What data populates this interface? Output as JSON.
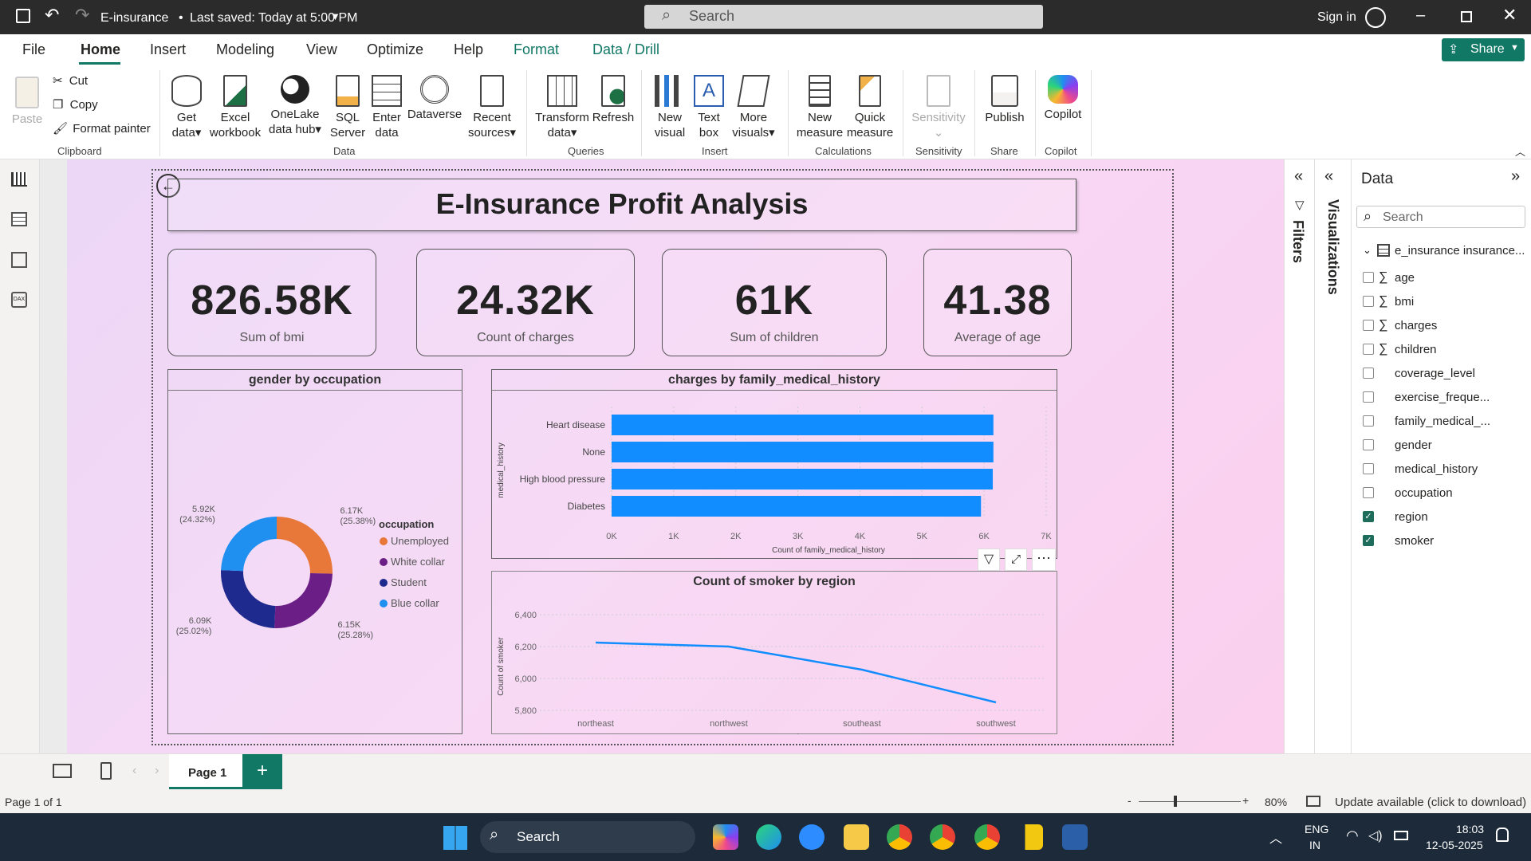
{
  "titlebar": {
    "doc": "E-insurance",
    "saved": "Last saved: Today at 5:00 PM",
    "search": "Search",
    "signin": "Sign in"
  },
  "menu": {
    "file": "File",
    "home": "Home",
    "insert": "Insert",
    "modeling": "Modeling",
    "view": "View",
    "optimize": "Optimize",
    "help": "Help",
    "format": "Format",
    "datadrill": "Data / Drill",
    "share": "Share"
  },
  "ribbon": {
    "paste": "Paste",
    "cut": "Cut",
    "copy": "Copy",
    "format_painter": "Format painter",
    "clipboard": "Clipboard",
    "get_data_1": "Get",
    "get_data_2": "data",
    "excel_1": "Excel",
    "excel_2": "workbook",
    "onelake_1": "OneLake",
    "onelake_2": "data hub",
    "sql_1": "SQL",
    "sql_2": "Server",
    "enter_1": "Enter",
    "enter_2": "data",
    "dataverse": "Dataverse",
    "recent_1": "Recent",
    "recent_2": "sources",
    "data": "Data",
    "transform_1": "Transform",
    "transform_2": "data",
    "refresh": "Refresh",
    "queries": "Queries",
    "newvisual_1": "New",
    "newvisual_2": "visual",
    "textbox_1": "Text",
    "textbox_2": "box",
    "more_1": "More",
    "more_2": "visuals",
    "insert": "Insert",
    "newmeasure_1": "New",
    "newmeasure_2": "measure",
    "quick_1": "Quick",
    "quick_2": "measure",
    "calculations": "Calculations",
    "sensitivity": "Sensitivity",
    "sensitivity_group": "Sensitivity",
    "publish": "Publish",
    "share_group": "Share",
    "copilot": "Copilot",
    "copilot_group": "Copilot"
  },
  "report": {
    "title": "E-Insurance Profit Analysis",
    "kpis": [
      {
        "value": "826.58K",
        "label": "Sum of bmi"
      },
      {
        "value": "24.32K",
        "label": "Count of charges"
      },
      {
        "value": "61K",
        "label": "Sum of children"
      },
      {
        "value": "41.38",
        "label": "Average of age"
      }
    ]
  },
  "donut": {
    "title": "gender by occupation",
    "legend_title": "occupation",
    "labels": [
      {
        "v": "6.17K",
        "p": "(25.38%)"
      },
      {
        "v": "6.15K",
        "p": "(25.28%)"
      },
      {
        "v": "6.09K",
        "p": "(25.02%)"
      },
      {
        "v": "5.92K",
        "p": "(24.32%)"
      }
    ]
  },
  "bar": {
    "title": "charges by family_medical_history",
    "ylabel": "medical_history",
    "xlabel": "Count of family_medical_history"
  },
  "line": {
    "title": "Count of smoker by region",
    "ylabel": "Count of smoker",
    "xlabel": "region"
  },
  "chart_data": [
    {
      "type": "pie",
      "title": "gender by occupation",
      "legend": "occupation",
      "categories": [
        "Unemployed",
        "White collar",
        "Student",
        "Blue collar"
      ],
      "values": [
        6170,
        6150,
        6090,
        5920
      ],
      "colors": [
        "#e8773a",
        "#6b1f86",
        "#1f2a8f",
        "#1f8ff0"
      ]
    },
    {
      "type": "bar",
      "title": "charges by family_medical_history",
      "orientation": "horizontal",
      "categories": [
        "Heart disease",
        "None",
        "High blood pressure",
        "Diabetes"
      ],
      "values": [
        6150,
        6150,
        6140,
        5950
      ],
      "xticks": [
        "0K",
        "1K",
        "2K",
        "3K",
        "4K",
        "5K",
        "6K",
        "7K"
      ],
      "xlim": [
        0,
        7000
      ],
      "xlabel": "Count of family_medical_history",
      "ylabel": "medical_history"
    },
    {
      "type": "line",
      "title": "Count of smoker by region",
      "categories": [
        "northeast",
        "northwest",
        "southeast",
        "southwest"
      ],
      "values": [
        6225,
        6200,
        6055,
        5850
      ],
      "yticks": [
        "6,400",
        "6,200",
        "6,000",
        "5,800"
      ],
      "ylim": [
        5800,
        6400
      ],
      "xlabel": "region",
      "ylabel": "Count of smoker"
    }
  ],
  "panes": {
    "filters": "Filters",
    "visualizations": "Visualizations",
    "data": "Data",
    "search": "Search",
    "table": "e_insurance insurance..."
  },
  "fields": [
    {
      "name": "age",
      "sigma": "∑",
      "checked": false
    },
    {
      "name": "bmi",
      "sigma": "∑",
      "checked": false
    },
    {
      "name": "charges",
      "sigma": "∑",
      "checked": false
    },
    {
      "name": "children",
      "sigma": "∑",
      "checked": false
    },
    {
      "name": "coverage_level",
      "sigma": "",
      "checked": false
    },
    {
      "name": "exercise_freque...",
      "sigma": "",
      "checked": false
    },
    {
      "name": "family_medical_...",
      "sigma": "",
      "checked": false
    },
    {
      "name": "gender",
      "sigma": "",
      "checked": false
    },
    {
      "name": "medical_history",
      "sigma": "",
      "checked": false
    },
    {
      "name": "occupation",
      "sigma": "",
      "checked": false
    },
    {
      "name": "region",
      "sigma": "",
      "checked": true
    },
    {
      "name": "smoker",
      "sigma": "",
      "checked": true
    }
  ],
  "pagetab": "Page 1",
  "status": {
    "page": "Page 1 of 1",
    "zoom": "80%",
    "update": "Update available (click to download)"
  },
  "taskbar": {
    "search": "Search",
    "lang1": "ENG",
    "lang2": "IN",
    "time": "18:03",
    "date": "12-05-2025"
  }
}
